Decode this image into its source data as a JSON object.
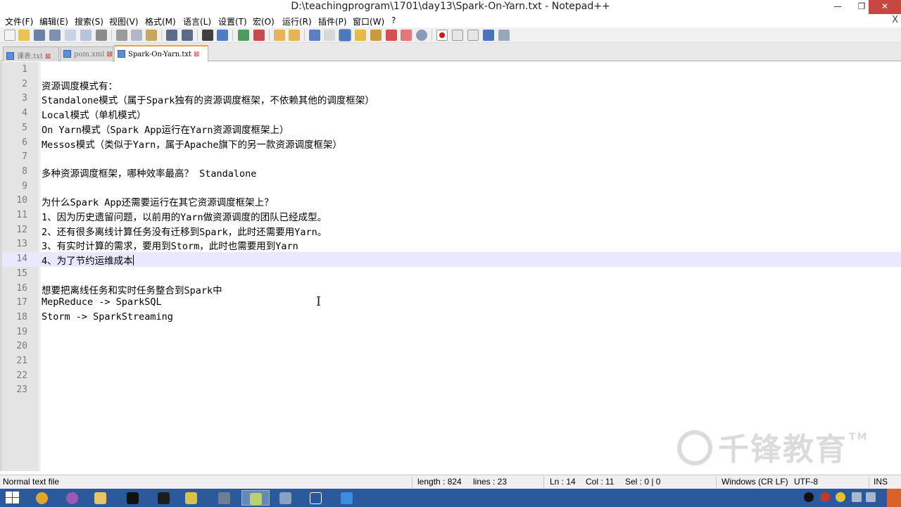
{
  "window": {
    "title": "D:\\teachingprogram\\1701\\day13\\Spark-On-Yarn.txt - Notepad++",
    "minimize": "—",
    "maximize": "❐",
    "close": "✕"
  },
  "menu": {
    "items": [
      "文件(F)",
      "编辑(E)",
      "搜索(S)",
      "视图(V)",
      "格式(M)",
      "语言(L)",
      "设置(T)",
      "宏(O)",
      "运行(R)",
      "插件(P)",
      "窗口(W)",
      "?"
    ],
    "close_glyph": "X"
  },
  "tabs": [
    {
      "label": "课表.txt",
      "active": false
    },
    {
      "label": "pom.xml",
      "active": false
    },
    {
      "label": "Spark-On-Yarn.txt",
      "active": true
    }
  ],
  "tab_close_glyph": "⊠",
  "editor": {
    "current_line": 14,
    "lines": [
      {
        "n": "1",
        "text": ""
      },
      {
        "n": "2",
        "text": "资源调度模式有："
      },
      {
        "n": "3",
        "text": "Standalone模式（属于Spark独有的资源调度框架，不依赖其他的调度框架）"
      },
      {
        "n": "4",
        "text": "Local模式（单机模式）"
      },
      {
        "n": "5",
        "text": "On Yarn模式（Spark App运行在Yarn资源调度框架上）"
      },
      {
        "n": "6",
        "text": "Messos模式（类似于Yarn，属于Apache旗下的另一款资源调度框架）"
      },
      {
        "n": "7",
        "text": ""
      },
      {
        "n": "8",
        "text": "多种资源调度框架，哪种效率最高？ Standalone"
      },
      {
        "n": "9",
        "text": ""
      },
      {
        "n": "10",
        "text": "为什么Spark App还需要运行在其它资源调度框架上？"
      },
      {
        "n": "11",
        "text": "1、因为历史遗留问题，以前用的Yarn做资源调度的团队已经成型。"
      },
      {
        "n": "12",
        "text": "2、还有很多离线计算任务没有迁移到Spark，此时还需要用Yarn。"
      },
      {
        "n": "13",
        "text": "3、有实时计算的需求，要用到Storm，此时也需要用到Yarn"
      },
      {
        "n": "14",
        "text": "4、为了节约运维成本"
      },
      {
        "n": "15",
        "text": ""
      },
      {
        "n": "16",
        "text": "想要把离线任务和实时任务整合到Spark中"
      },
      {
        "n": "17",
        "text": "MepReduce -> SparkSQL"
      },
      {
        "n": "18",
        "text": "Storm -> SparkStreaming"
      },
      {
        "n": "19",
        "text": ""
      },
      {
        "n": "20",
        "text": ""
      },
      {
        "n": "21",
        "text": ""
      },
      {
        "n": "22",
        "text": ""
      },
      {
        "n": "23",
        "text": ""
      }
    ]
  },
  "watermark": {
    "text": "千锋教育",
    "tm": "TM"
  },
  "status": {
    "file_type": "Normal text file",
    "length": "length : 824",
    "lines": "lines : 23",
    "ln": "Ln : 14",
    "col": "Col : 11",
    "sel": "Sel : 0 | 0",
    "eol": "Windows (CR LF)",
    "encoding": "UTF-8",
    "mode": "INS"
  },
  "colors": {
    "current_line": "#e8e8ff",
    "gutter": "#e4e4e4",
    "taskbar": "#2b5a9c",
    "close_button": "#c7463f"
  }
}
